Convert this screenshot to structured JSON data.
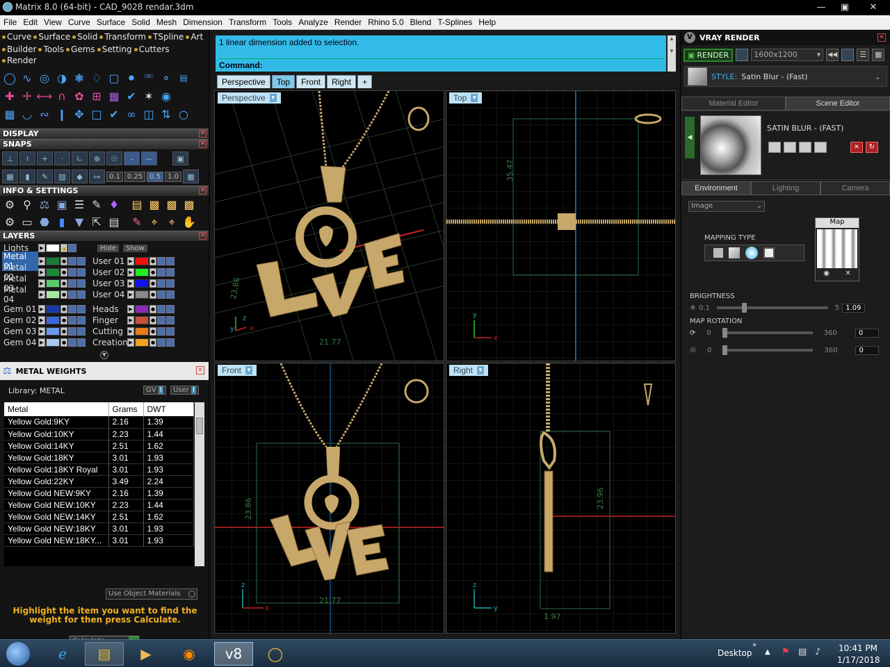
{
  "window": {
    "title": "Matrix 8.0 (64-bit) - CAD_9028 rendar.3dm"
  },
  "menu": [
    "File",
    "Edit",
    "View",
    "Curve",
    "Surface",
    "Solid",
    "Mesh",
    "Dimension",
    "Transform",
    "Tools",
    "Analyze",
    "Render",
    "Rhino 5.0",
    "Blend",
    "T-Splines",
    "Help"
  ],
  "tabs_row1": [
    "Curve",
    "Surface",
    "Solid",
    "Transform",
    "TSpline",
    "Art"
  ],
  "tabs_row2": [
    "Builder",
    "Tools",
    "Gems",
    "Setting",
    "Cutters",
    "Render"
  ],
  "panels": {
    "display": "DISPLAY",
    "snaps": "SNAPS",
    "info": "INFO & SETTINGS",
    "layers": "LAYERS",
    "weights": "METAL WEIGHTS"
  },
  "snap_values": [
    "0.1",
    "0.25",
    "0.5",
    "1.0"
  ],
  "layers": {
    "lights": "Lights",
    "hide": "Hide",
    "show": "Show",
    "left": [
      {
        "name": "Metal 01",
        "color": "#1a7a3a"
      },
      {
        "name": "Metal 02",
        "color": "#1a8a3a"
      },
      {
        "name": "Metal 03",
        "color": "#5acc6a"
      },
      {
        "name": "Metal 04",
        "color": "#a8e8a0"
      },
      {
        "name": "Gem 01",
        "color": "#1a3aa8"
      },
      {
        "name": "Gem 02",
        "color": "#3a6ad8"
      },
      {
        "name": "Gem 03",
        "color": "#6a9ae8"
      },
      {
        "name": "Gem 04",
        "color": "#a8c8f0"
      }
    ],
    "right": [
      {
        "name": "User 01",
        "color": "#ee1111"
      },
      {
        "name": "User 02",
        "color": "#22ee22"
      },
      {
        "name": "User 03",
        "color": "#1111ee"
      },
      {
        "name": "User 04",
        "color": "#888888"
      },
      {
        "name": "Heads",
        "color": "#8a2ab8"
      },
      {
        "name": "Finger",
        "color": "#c8503a"
      },
      {
        "name": "Cutting",
        "color": "#e87a1a"
      },
      {
        "name": "Creation",
        "color": "#f0a020"
      }
    ]
  },
  "weights": {
    "library": "Library: METAL",
    "gv": "GV",
    "user": "User",
    "columns": [
      "Metal",
      "Grams",
      "DWT"
    ],
    "rows": [
      [
        "Yellow Gold:9KY",
        "2.16",
        "1.39"
      ],
      [
        "Yellow Gold:10KY",
        "2.23",
        "1.44"
      ],
      [
        "Yellow Gold:14KY",
        "2.51",
        "1.62"
      ],
      [
        "Yellow Gold:18KY",
        "3.01",
        "1.93"
      ],
      [
        "Yellow Gold:18KY Royal",
        "3.01",
        "1.93"
      ],
      [
        "Yellow Gold:22KY",
        "3.49",
        "2.24"
      ],
      [
        "Yellow Gold NEW:9KY",
        "2.16",
        "1.39"
      ],
      [
        "Yellow Gold NEW:10KY",
        "2.23",
        "1.44"
      ],
      [
        "Yellow Gold NEW:14KY",
        "2.51",
        "1.62"
      ],
      [
        "Yellow Gold NEW:18KY",
        "3.01",
        "1.93"
      ],
      [
        "Yellow Gold NEW:18KY...",
        "3.01",
        "1.93"
      ]
    ],
    "use_object": "Use Object Materials",
    "hint": "Highlight the item you want to find the weight for then press Calculate.",
    "calculate": "Calculate"
  },
  "command": {
    "message": "1 linear dimension added to selection.",
    "prompt": "Command:"
  },
  "viewport_tabs": [
    "Perspective",
    "Top",
    "Front",
    "Right",
    "+"
  ],
  "viewports": {
    "perspective": "Perspective",
    "top": "Top",
    "front": "Front",
    "right": "Right"
  },
  "dims": {
    "persp_a": "23.86",
    "persp_b": "21.77",
    "top_a": "35.47",
    "front_a": "23.86",
    "front_b": "21.77",
    "right_a": "23.96",
    "right_b": "1.97"
  },
  "vray": {
    "title": "VRAY RENDER",
    "render": "RENDER",
    "resolution": "1600x1200",
    "style_label": "STYLE:",
    "style_value": "Satin Blur - (Fast)",
    "tab_material": "Material Editor",
    "tab_scene": "Scene Editor",
    "material_name": "SATIN BLUR - (FAST)",
    "tab_env": "Environment",
    "tab_light": "Lighting",
    "tab_camera": "Camera",
    "env_type": "Image",
    "map_label": "Map",
    "mapping_type": "MAPPING TYPE",
    "brightness": "BRIGHTNESS",
    "brightness_min": "0.1",
    "brightness_max": "5",
    "brightness_val": "1.09",
    "map_rotation": "MAP ROTATION",
    "rot_min": "0",
    "rot_max": "360",
    "rot1_val": "0",
    "rot2_val": "0"
  },
  "taskbar": {
    "desktop": "Desktop",
    "time": "10:41 PM",
    "date": "1/17/2018"
  },
  "colors": {
    "accent": "#33bbe8",
    "gold": "#c8a86a",
    "grid": "#2a3a2a"
  }
}
